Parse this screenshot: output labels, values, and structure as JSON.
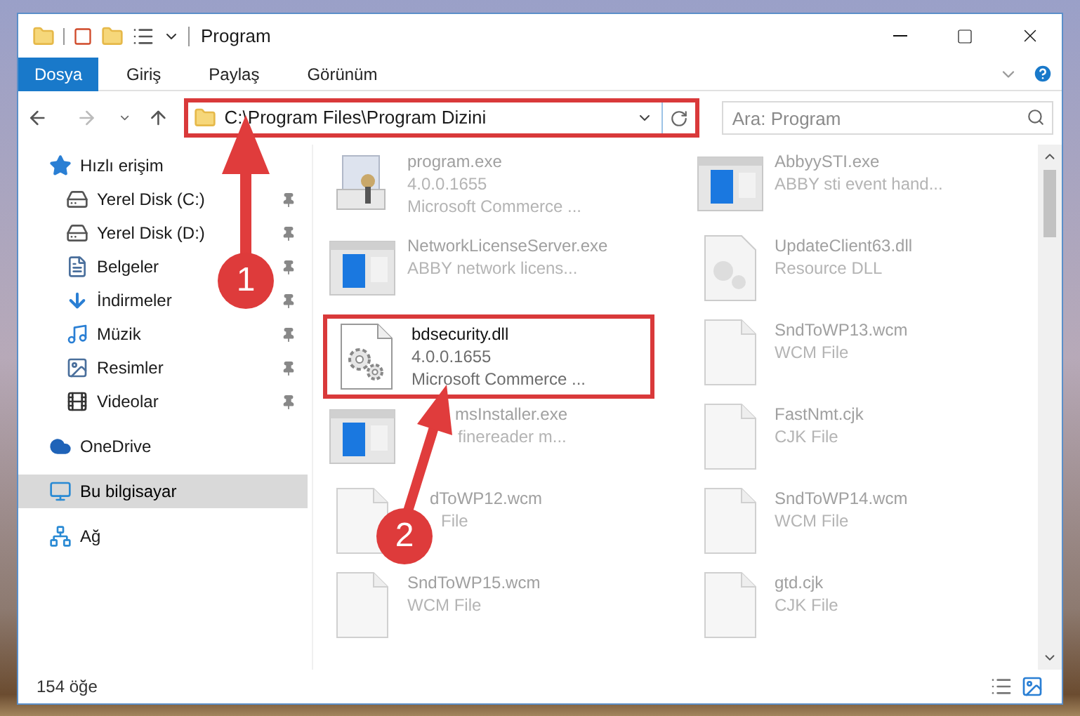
{
  "window": {
    "title": "Program"
  },
  "ribbon_tabs": [
    {
      "label": "Dosya",
      "selected": true
    },
    {
      "label": "Giriş",
      "selected": false
    },
    {
      "label": "Paylaş",
      "selected": false
    },
    {
      "label": "Görünüm",
      "selected": false
    }
  ],
  "address": {
    "path": "C:\\Program Files\\Program Dizini",
    "highlighted": true
  },
  "search": {
    "placeholder": "Ara: Program"
  },
  "sidebar": {
    "items": [
      {
        "label": "Hızlı erişim",
        "kind": "quick",
        "pinned": false,
        "selected": false,
        "children": [
          {
            "label": "Yerel Disk (C:)",
            "kind": "drive",
            "pinned": true,
            "selected": false
          },
          {
            "label": "Yerel Disk (D:)",
            "kind": "drive",
            "pinned": true,
            "selected": false
          },
          {
            "label": "Belgeler",
            "kind": "documents",
            "pinned": true,
            "selected": false
          },
          {
            "label": "İndirmeler",
            "kind": "downloads",
            "pinned": true,
            "selected": false
          },
          {
            "label": "Müzik",
            "kind": "music",
            "pinned": true,
            "selected": false
          },
          {
            "label": "Resimler",
            "kind": "pictures",
            "pinned": true,
            "selected": false
          },
          {
            "label": "Videolar",
            "kind": "videos",
            "pinned": true,
            "selected": false
          }
        ]
      },
      {
        "label": "OneDrive",
        "kind": "cloud",
        "pinned": false,
        "selected": false
      },
      {
        "label": "Bu bilgisayar",
        "kind": "computer",
        "pinned": false,
        "selected": true
      },
      {
        "label": "Ağ",
        "kind": "network",
        "pinned": false,
        "selected": false
      }
    ]
  },
  "files": [
    {
      "name": "program.exe",
      "details": [
        "4.0.0.1655",
        "Microsoft Commerce ..."
      ],
      "kind": "installer",
      "blurred": true,
      "highlighted": false
    },
    {
      "name": "AbbyySTI.exe",
      "details": [
        "ABBY sti event hand..."
      ],
      "kind": "exe",
      "blurred": true,
      "highlighted": false
    },
    {
      "name": "NetworkLicenseServer.exe",
      "details": [
        "ABBY network licens..."
      ],
      "kind": "exe",
      "blurred": true,
      "highlighted": false
    },
    {
      "name": "UpdateClient63.dll",
      "details": [
        "Resource DLL"
      ],
      "kind": "resource",
      "blurred": true,
      "highlighted": false
    },
    {
      "name": "bdsecurity.dll",
      "details": [
        "4.0.0.1655",
        "Microsoft Commerce ..."
      ],
      "kind": "dll",
      "blurred": false,
      "highlighted": true
    },
    {
      "name": "SndToWP13.wcm",
      "details": [
        "WCM File"
      ],
      "kind": "file",
      "blurred": true,
      "highlighted": false
    },
    {
      "name": "msInstaller.exe",
      "details": [
        "finereader m..."
      ],
      "kind": "exe",
      "blurred": true,
      "highlighted": false
    },
    {
      "name": "FastNmt.cjk",
      "details": [
        "CJK File"
      ],
      "kind": "file",
      "blurred": true,
      "highlighted": false
    },
    {
      "name": "dToWP12.wcm",
      "details": [
        "File"
      ],
      "kind": "file",
      "blurred": true,
      "highlighted": false
    },
    {
      "name": "SndToWP14.wcm",
      "details": [
        "WCM File"
      ],
      "kind": "file",
      "blurred": true,
      "highlighted": false
    },
    {
      "name": "SndToWP15.wcm",
      "details": [
        "WCM File"
      ],
      "kind": "file",
      "blurred": true,
      "highlighted": false
    },
    {
      "name": "gtd.cjk",
      "details": [
        "CJK File"
      ],
      "kind": "file",
      "blurred": true,
      "highlighted": false
    }
  ],
  "status_bar": {
    "count": "154 öğe"
  },
  "annotations": [
    {
      "number": "1"
    },
    {
      "number": "2"
    }
  ]
}
